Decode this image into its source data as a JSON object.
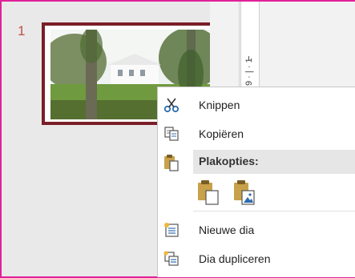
{
  "slide_panel": {
    "slide_number": "1"
  },
  "ruler": {
    "label": "9 · | · 1"
  },
  "context_menu": {
    "items": [
      {
        "label": "Knippen",
        "mnemonic": "n",
        "icon": "scissors-icon"
      },
      {
        "label": "Kopiëren",
        "mnemonic": "K",
        "icon": "copy-icon"
      }
    ],
    "paste_header": "Plakopties:",
    "paste_options": [
      {
        "name": "keep-source-formatting",
        "icon": "clipboard-paste-icon"
      },
      {
        "name": "picture",
        "icon": "clipboard-picture-icon"
      }
    ],
    "bottom_items": [
      {
        "label": "Nieuwe dia",
        "mnemonic": "w",
        "icon": "new-slide-icon"
      },
      {
        "label": "Dia dupliceren",
        "mnemonic": "i",
        "icon": "duplicate-slide-icon"
      }
    ]
  },
  "colors": {
    "outer_frame": "#e0219a",
    "thumb_border": "#7a1f27",
    "slide_number": "#c0504d",
    "icon_blue": "#2b6cb0",
    "icon_gold": "#c8a14a"
  }
}
